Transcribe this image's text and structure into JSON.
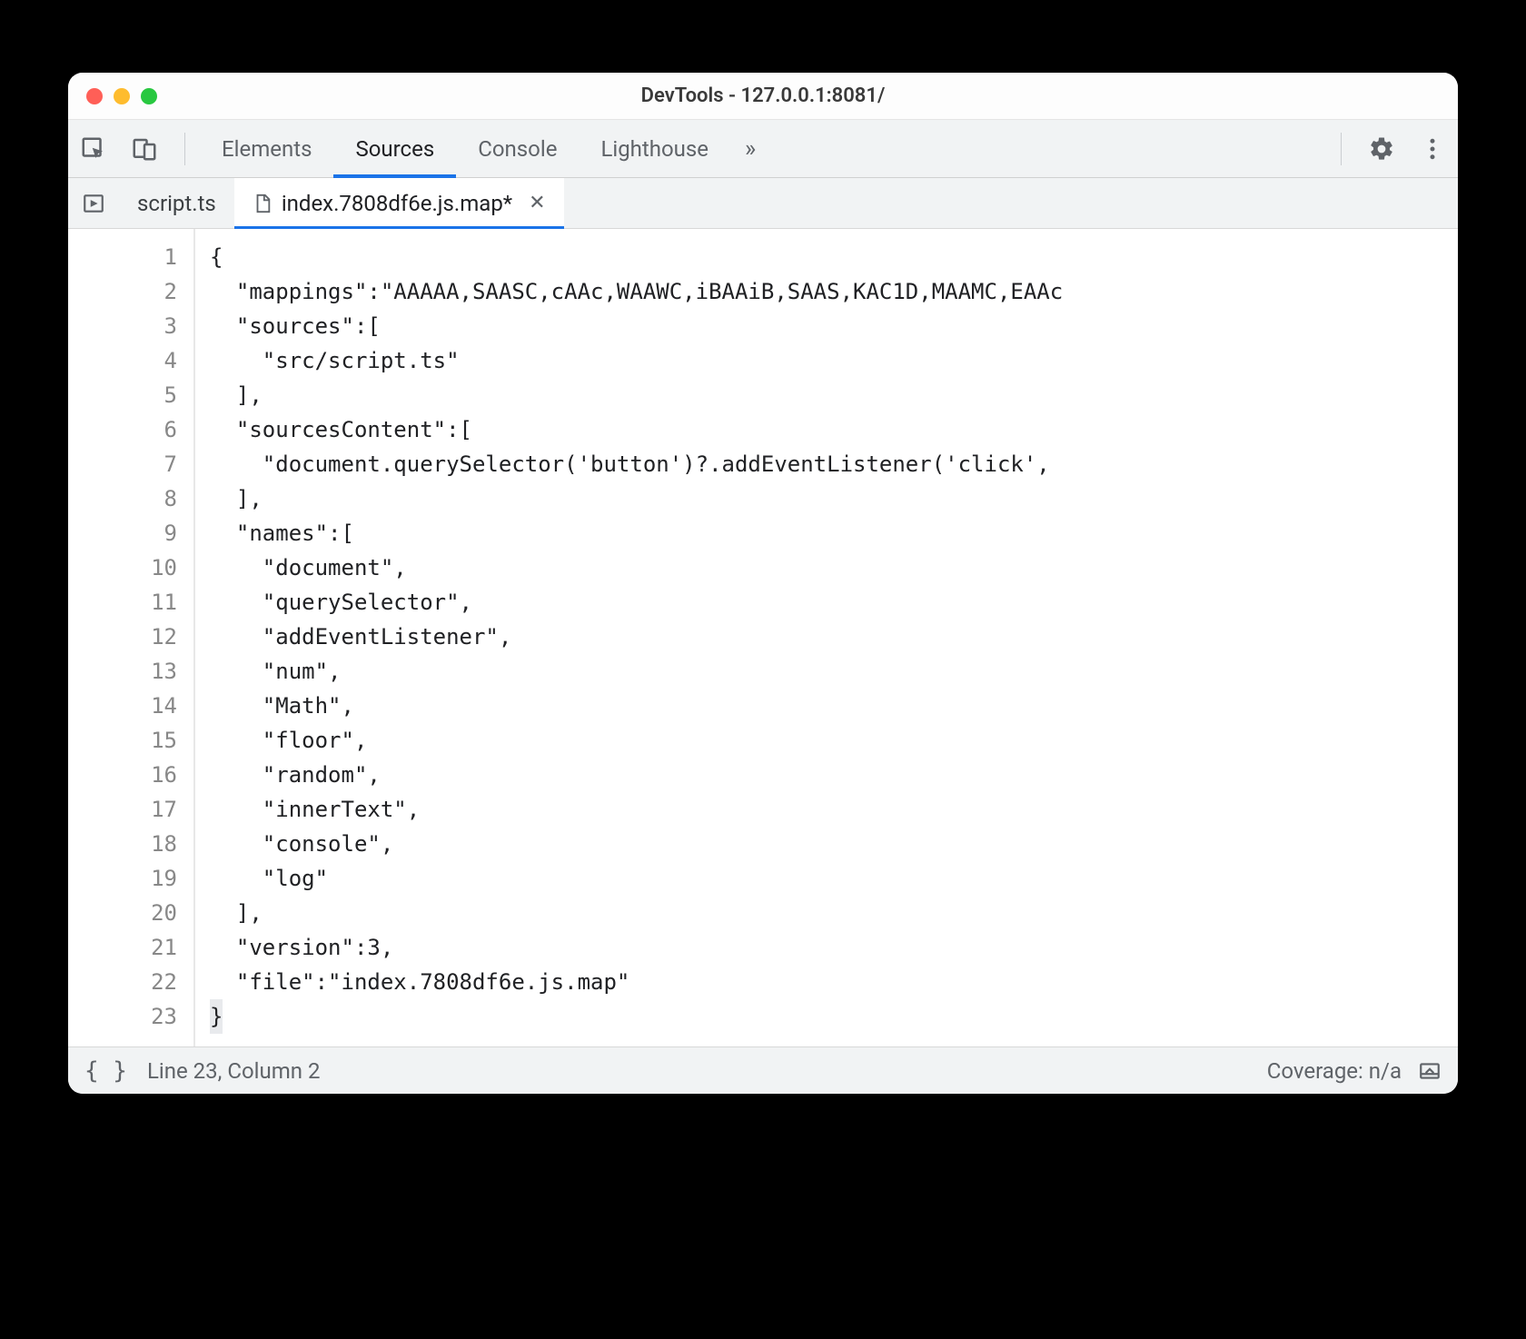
{
  "window": {
    "title": "DevTools - 127.0.0.1:8081/"
  },
  "mainTabs": {
    "items": [
      "Elements",
      "Sources",
      "Console",
      "Lighthouse"
    ],
    "activeIndex": 1
  },
  "fileTabs": {
    "items": [
      {
        "label": "script.ts",
        "modified": false,
        "icon": null
      },
      {
        "label": "index.7808df6e.js.map*",
        "modified": true,
        "icon": "file"
      }
    ],
    "activeIndex": 1
  },
  "editor": {
    "lines": [
      "{",
      "  \"mappings\":\"AAAAA,SAASC,cAAc,WAAWC,iBAAiB,SAAS,KAC1D,MAAMC,EAAc",
      "  \"sources\":[",
      "    \"src/script.ts\"",
      "  ],",
      "  \"sourcesContent\":[",
      "    \"document.querySelector('button')?.addEventListener('click',",
      "  ],",
      "  \"names\":[",
      "    \"document\",",
      "    \"querySelector\",",
      "    \"addEventListener\",",
      "    \"num\",",
      "    \"Math\",",
      "    \"floor\",",
      "    \"random\",",
      "    \"innerText\",",
      "    \"console\",",
      "    \"log\"",
      "  ],",
      "  \"version\":3,",
      "  \"file\":\"index.7808df6e.js.map\"",
      "}"
    ]
  },
  "statusbar": {
    "position": "Line 23, Column 2",
    "coverage": "Coverage: n/a"
  }
}
